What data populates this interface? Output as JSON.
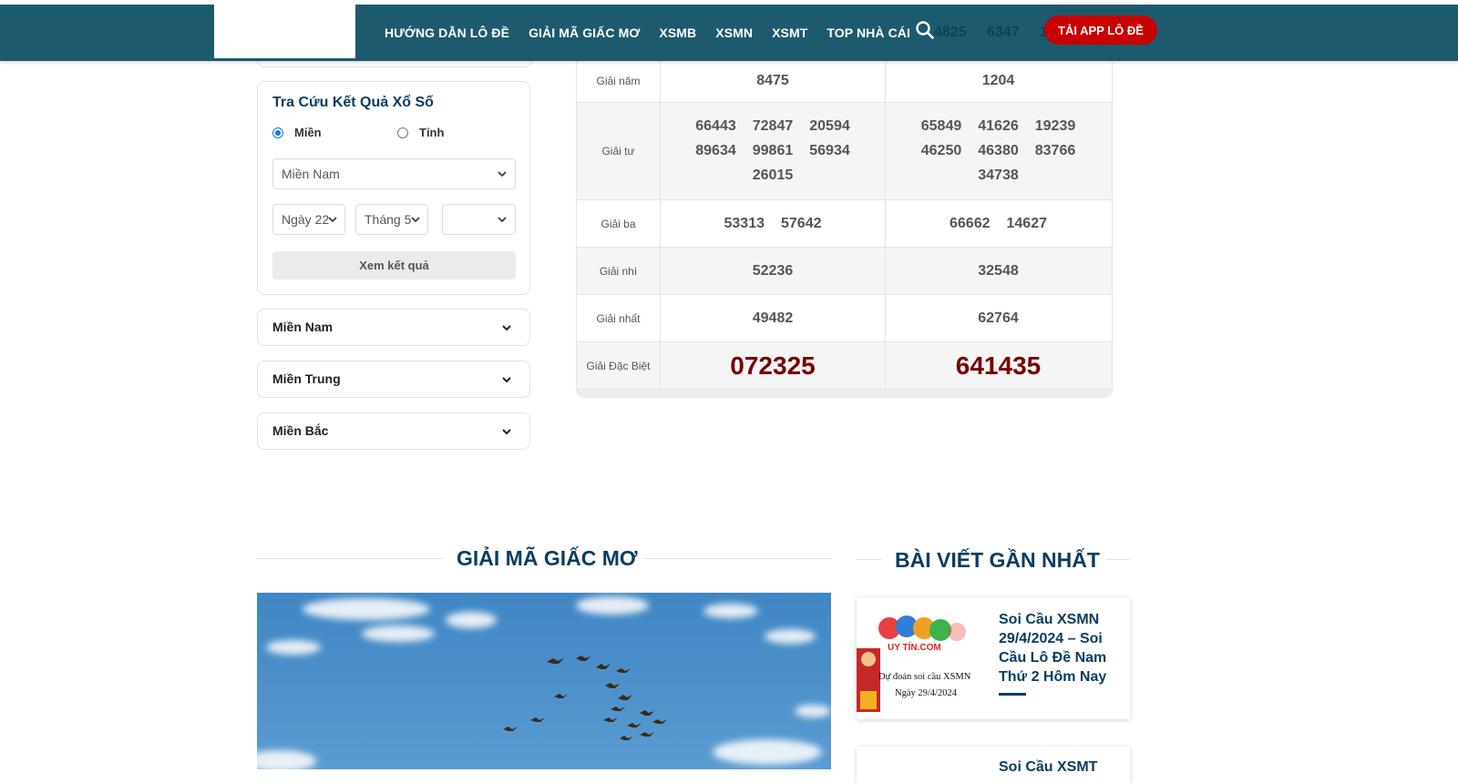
{
  "header": {
    "nav": [
      "HƯỚNG DẪN LÔ ĐỀ",
      "GIẢI MÃ GIẤC MƠ",
      "XSMB",
      "XSMN",
      "XSMT",
      "TOP NHÀ CÁI"
    ],
    "ghost_numbers": "4825 6347 1",
    "app_button": "TẢI APP LÔ ĐỀ",
    "bg_color": "#1d5a6e",
    "button_color": "#c80000"
  },
  "lookup": {
    "title": "Tra Cứu Kết Quả Xổ Số",
    "radio_region": "Miền",
    "radio_province": "Tỉnh",
    "selected_radio": "Miền",
    "region_select": "Miền Nam",
    "day_select": "Ngày 22",
    "month_select": "Tháng 5",
    "year_select": "",
    "submit": "Xem kết quả"
  },
  "regions": [
    "Miền Nam",
    "Miền Trung",
    "Miền Bắc"
  ],
  "results": {
    "rows": [
      {
        "label": "Giải năm",
        "a": [
          "8475"
        ],
        "b": [
          "1204"
        ]
      },
      {
        "label": "Giải tư",
        "a": [
          "66443",
          "72847",
          "20594",
          "89634",
          "99861",
          "56934",
          "26015"
        ],
        "b": [
          "65849",
          "41626",
          "19239",
          "46250",
          "46380",
          "83766",
          "34738"
        ]
      },
      {
        "label": "Giải ba",
        "a": [
          "53313",
          "57642"
        ],
        "b": [
          "66662",
          "14627"
        ]
      },
      {
        "label": "Giải nhì",
        "a": [
          "52236"
        ],
        "b": [
          "32548"
        ]
      },
      {
        "label": "Giải nhất",
        "a": [
          "49482"
        ],
        "b": [
          "62764"
        ]
      },
      {
        "label": "Giải Đặc Biệt",
        "a": [
          "072325"
        ],
        "b": [
          "641435"
        ]
      }
    ],
    "special_color": "#7a0000"
  },
  "sections": {
    "dream": "GIẢI MÃ GIẤC MƠ",
    "recent": "BÀI VIẾT GẦN NHẤT"
  },
  "posts": [
    {
      "title": "Soi Cầu XSMN 29/4/2024 – Soi Cầu Lô Đề Nam Thứ 2 Hôm Nay",
      "thumb_brand": "UY TÍN.COM",
      "thumb_caption_1": "Dự đoán soi cầu XSMN",
      "thumb_caption_2": "Ngày 29/4/2024"
    },
    {
      "title": "Soi Cầu XSMT"
    }
  ]
}
